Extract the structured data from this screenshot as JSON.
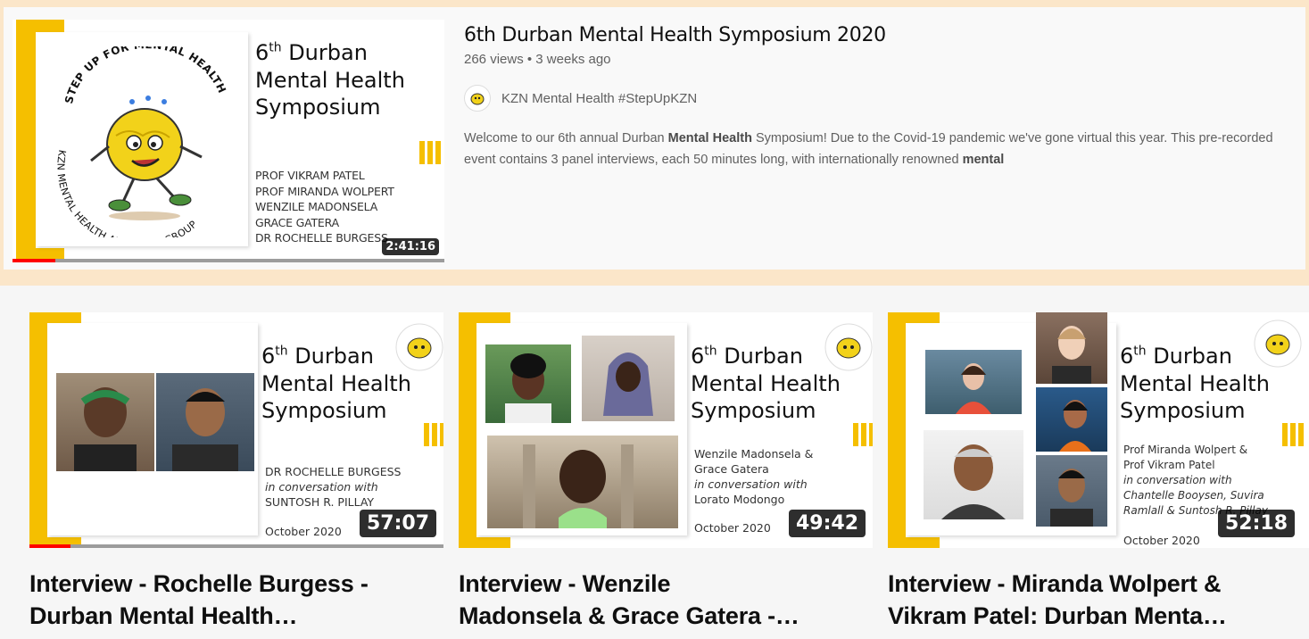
{
  "result": {
    "title": "6th Durban Mental Health Symposium 2020",
    "views": "266 views",
    "age": "3 weeks ago",
    "channel": "KZN Mental Health #StepUpKZN",
    "description_part1": "Welcome to our 6th annual Durban ",
    "description_bold1": "Mental Health",
    "description_part2": " Symposium! Due to the Covid-19 pandemic we've gone virtual this year. This pre-recorded event contains 3 panel interviews, each 50 minutes long, with internationally renowned ",
    "description_bold2": "mental",
    "duration": "2:41:16",
    "progress_fraction": 0.1,
    "thumbnail": {
      "title_lines": [
        "6",
        "th",
        " Durban",
        "Mental Health",
        "Symposium"
      ],
      "logo_top": "STEP UP FOR MENTAL HEALTH",
      "logo_bottom": "KZN MENTAL HEALTH ADVOCACY GROUP",
      "speakers": [
        "PROF VIKRAM PATEL",
        "PROF MIRANDA WOLPERT",
        "WENZILE MADONSELA",
        "GRACE GATERA",
        "DR ROCHELLE BURGESS"
      ]
    }
  },
  "videos": [
    {
      "title_line1": "Interview - Rochelle Burgess -",
      "title_line2": "Durban Mental Health…",
      "duration": "57:07",
      "progress_fraction": 0.1,
      "thumb_title": [
        "6",
        "th",
        " Durban",
        "Mental Health",
        "Symposium"
      ],
      "caption": [
        "DR ROCHELLE BURGESS",
        "in conversation with",
        "SUNTOSH R. PILLAY"
      ],
      "date": "October 2020"
    },
    {
      "title_line1": "Interview - Wenzile",
      "title_line2": "Madonsela & Grace Gatera -…",
      "duration": "49:42",
      "thumb_title": [
        "6",
        "th",
        " Durban",
        "Mental Health",
        "Symposium"
      ],
      "caption": [
        "Wenzile Madonsela &",
        "Grace Gatera",
        "in conversation with",
        "Lorato Modongo"
      ],
      "date": "October 2020"
    },
    {
      "title_line1": "Interview - Miranda Wolpert &",
      "title_line2": "Vikram Patel: Durban Menta…",
      "duration": "52:18",
      "thumb_title": [
        "6",
        "th",
        " Durban",
        "Mental Health",
        "Symposium"
      ],
      "caption": [
        "Prof Miranda Wolpert &",
        "Prof Vikram Patel",
        "in conversation with",
        "Chantelle Booysen, Suvira",
        "Ramlall & Suntosh R. Pillay"
      ],
      "date": "October 2020"
    }
  ],
  "colors": {
    "accent_yellow": "#f5bf00",
    "progress_red": "#ff0000",
    "page_bg": "#fbe6c9"
  }
}
